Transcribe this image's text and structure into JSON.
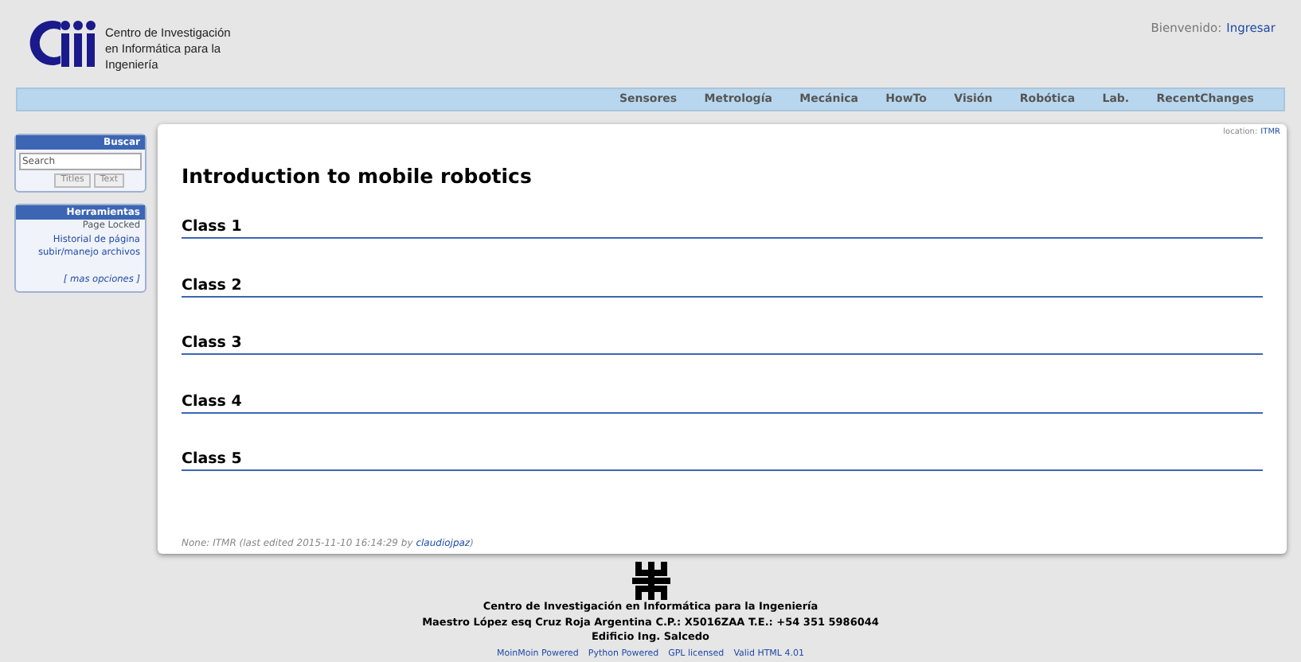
{
  "header": {
    "org_name": "Centro de Investigación en Informática para la Ingeniería",
    "welcome": "Bienvenido:",
    "login_link": "Ingresar"
  },
  "navbar": {
    "items": [
      "Sensores",
      "Metrología",
      "Mecánica",
      "HowTo",
      "Visión",
      "Robótica",
      "Lab.",
      "RecentChanges"
    ]
  },
  "sidebar": {
    "search_panel": {
      "title": "Buscar",
      "placeholder": "Search",
      "buttons": [
        "Titles",
        "Text"
      ]
    },
    "tools_panel": {
      "title": "Herramientas",
      "items": [
        {
          "text": "Page Locked",
          "kind": "text"
        },
        {
          "text": "Historial de página",
          "kind": "link"
        },
        {
          "text": "subir/manejo archivos",
          "kind": "link"
        },
        {
          "text": "[ mas opciones ]",
          "kind": "more"
        }
      ]
    }
  },
  "page": {
    "location_label": "location:",
    "location_link": "ITMR",
    "title": "Introduction to mobile robotics",
    "sections": [
      "Class 1",
      "Class 2",
      "Class 3",
      "Class 4",
      "Class 5"
    ],
    "footer_note": "None: ITMR (last edited 2015-11-10 16:14:29 by",
    "footer_author": "claudiojpaz",
    "footer_close": ")"
  },
  "footer": {
    "lines": [
      "Centro de Investigación en Informática para la Ingeniería",
      "Maestro López esq Cruz Roja Argentina C.P.: X5016ZAA T.E.: +54 351 5986044",
      "Edificio Ing. Salcedo"
    ],
    "links": [
      "MoinMoin Powered",
      "Python Powered",
      "GPL licensed",
      "Valid HTML 4.01"
    ]
  }
}
